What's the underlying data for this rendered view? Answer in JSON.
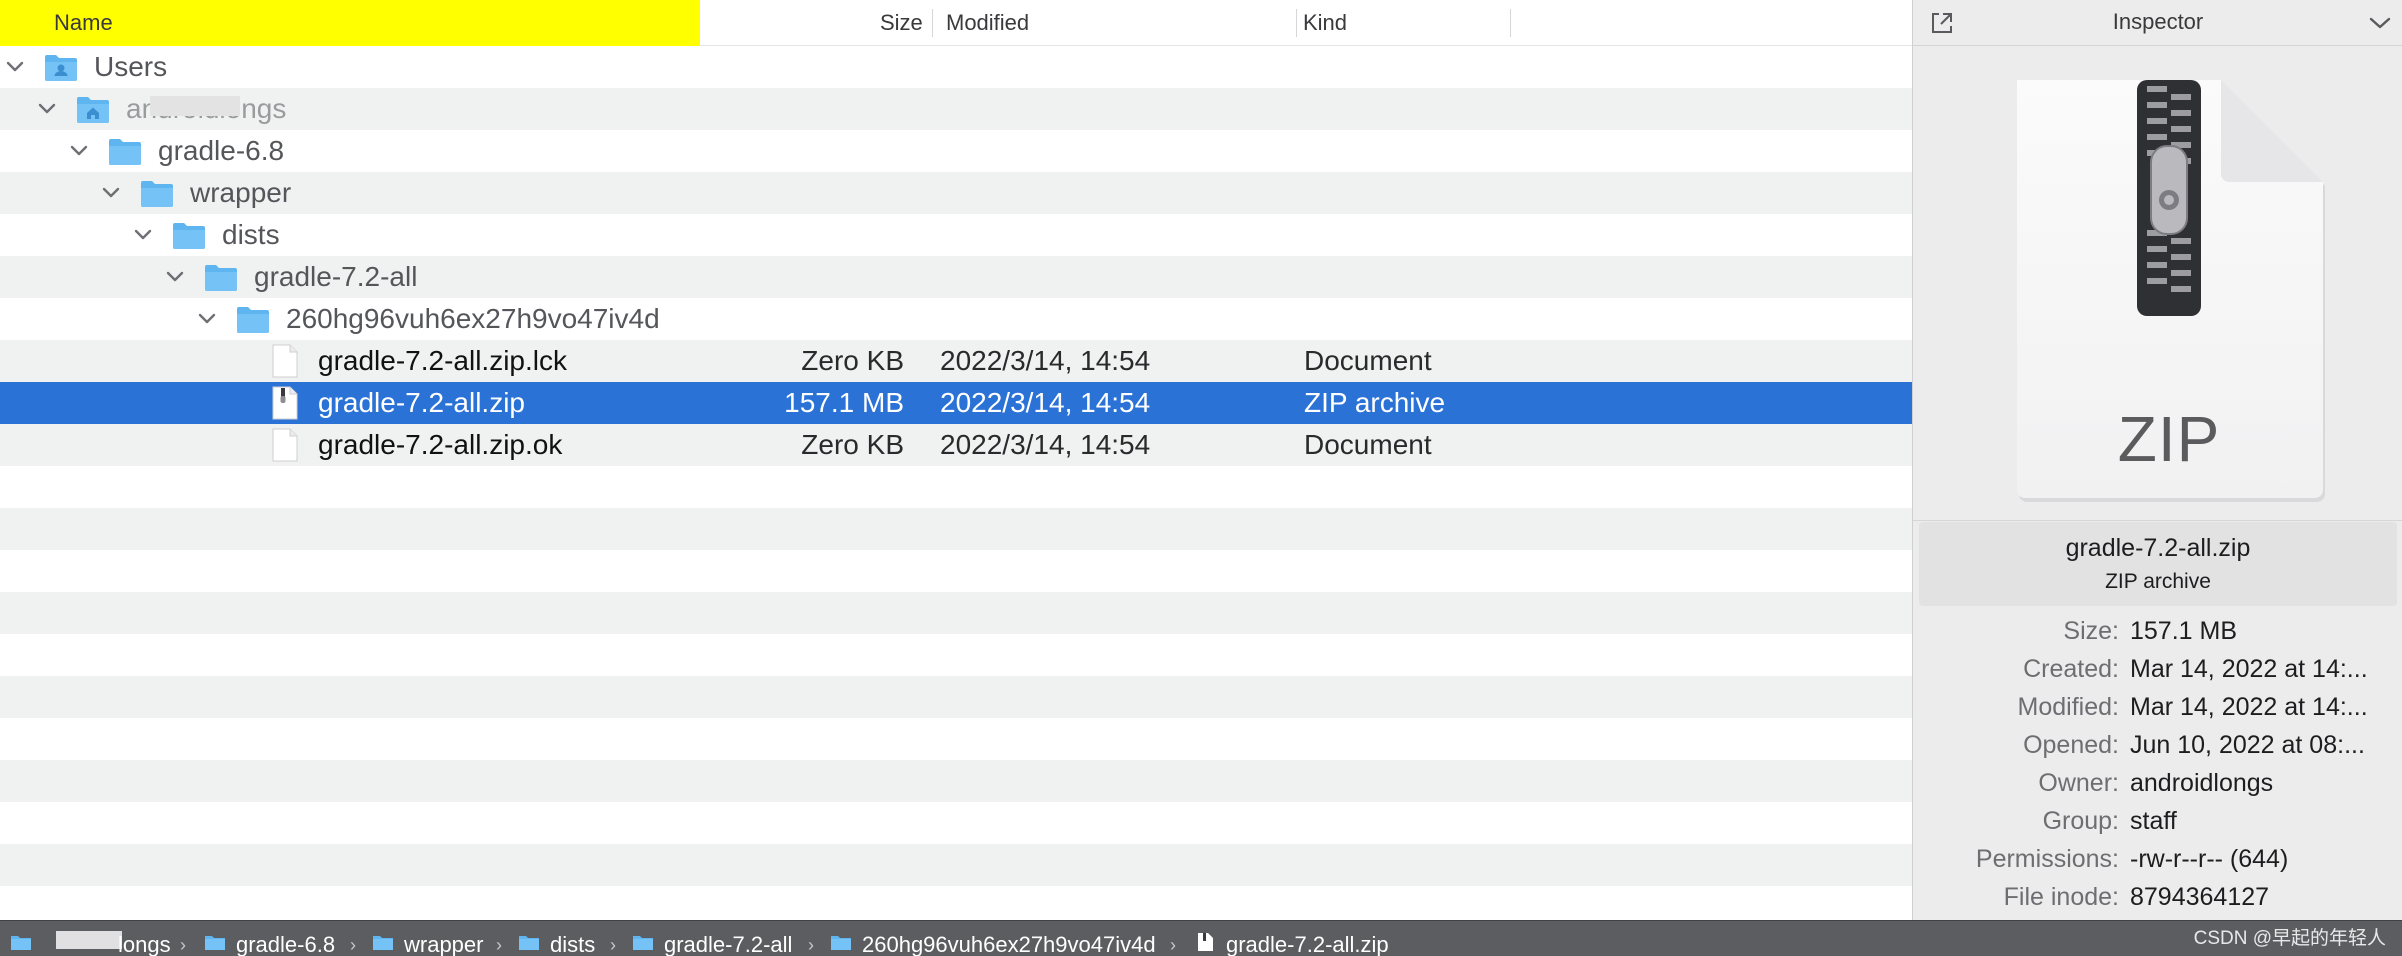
{
  "columns": {
    "name": "Name",
    "size": "Size",
    "modified": "Modified",
    "kind": "Kind"
  },
  "tree": [
    {
      "type": "folder",
      "name": "Users",
      "level": 0,
      "icon": "user-folder-icon"
    },
    {
      "type": "folder",
      "name": "androidlongs",
      "level": 1,
      "icon": "home-folder-icon"
    },
    {
      "type": "folder",
      "name": "gradle-6.8",
      "level": 2,
      "icon": "folder-icon"
    },
    {
      "type": "folder",
      "name": "wrapper",
      "level": 3,
      "icon": "folder-icon"
    },
    {
      "type": "folder",
      "name": "dists",
      "level": 4,
      "icon": "folder-icon"
    },
    {
      "type": "folder",
      "name": "gradle-7.2-all",
      "level": 5,
      "icon": "folder-icon"
    },
    {
      "type": "folder",
      "name": "260hg96vuh6ex27h9vo47iv4d",
      "level": 6,
      "icon": "folder-icon"
    }
  ],
  "files": [
    {
      "name": "gradle-7.2-all.zip.lck",
      "size": "Zero KB",
      "modified": "2022/3/14, 14:54",
      "kind": "Document",
      "selected": false
    },
    {
      "name": "gradle-7.2-all.zip",
      "size": "157.1 MB",
      "modified": "2022/3/14, 14:54",
      "kind": "ZIP archive",
      "selected": true
    },
    {
      "name": "gradle-7.2-all.zip.ok",
      "size": "Zero KB",
      "modified": "2022/3/14, 14:54",
      "kind": "Document",
      "selected": false
    }
  ],
  "inspector": {
    "title": "Inspector",
    "preview_label": "ZIP",
    "file_name": "gradle-7.2-all.zip",
    "file_kind": "ZIP archive",
    "properties": [
      {
        "key": "Size:",
        "value": "157.1 MB"
      },
      {
        "key": "Created:",
        "value": "Mar 14, 2022 at 14:..."
      },
      {
        "key": "Modified:",
        "value": "Mar 14, 2022 at 14:..."
      },
      {
        "key": "Opened:",
        "value": "Jun 10, 2022 at 08:..."
      },
      {
        "key": "Owner:",
        "value": "androidlongs"
      },
      {
        "key": "Group:",
        "value": "staff"
      },
      {
        "key": "Permissions:",
        "value": "-rw-r--r-- (644)"
      },
      {
        "key": "File inode:",
        "value": "8794364127"
      }
    ]
  },
  "pathbar": {
    "crumbs": [
      {
        "label": "longs",
        "icon": "home-folder-icon"
      },
      {
        "label": "gradle-6.8",
        "icon": "folder-icon"
      },
      {
        "label": "wrapper",
        "icon": "folder-icon"
      },
      {
        "label": "dists",
        "icon": "folder-icon"
      },
      {
        "label": "gradle-7.2-all",
        "icon": "folder-icon"
      },
      {
        "label": "260hg96vuh6ex27h9vo47iv4d",
        "icon": "folder-icon"
      },
      {
        "label": "gradle-7.2-all.zip",
        "icon": "zip-file-icon"
      }
    ],
    "watermark": "CSDN @早起的年轻人"
  },
  "colors": {
    "header_highlight": "#ffff00",
    "selection": "#2b72d7",
    "folder_blue": "#5fb5f0",
    "alt_row": "#f0f1f1"
  }
}
